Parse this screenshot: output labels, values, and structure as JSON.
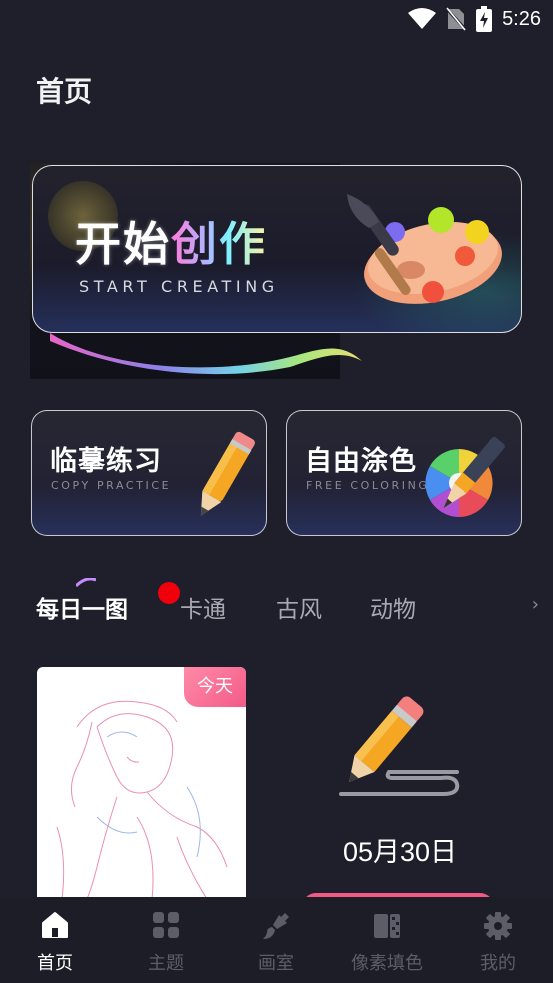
{
  "status_bar": {
    "time": "5:26"
  },
  "header": {
    "title": "首页"
  },
  "hero": {
    "title_white": "开始",
    "title_color": "创作",
    "subtitle": "START CREATING"
  },
  "cards": [
    {
      "title": "临摹练习",
      "subtitle": "COPY PRACTICE"
    },
    {
      "title": "自由涂色",
      "subtitle": "FREE COLORING"
    }
  ],
  "tabs": [
    {
      "label": "每日一图",
      "active": true
    },
    {
      "label": "卡通",
      "active": false
    },
    {
      "label": "古风",
      "active": false
    },
    {
      "label": "动物",
      "active": false
    }
  ],
  "daily": {
    "badge": "今天",
    "date": "05月30日"
  },
  "bottom_nav": [
    {
      "label": "首页",
      "icon": "home-icon",
      "active": true
    },
    {
      "label": "主题",
      "icon": "grid-icon",
      "active": false
    },
    {
      "label": "画室",
      "icon": "brush-icon",
      "active": false
    },
    {
      "label": "像素填色",
      "icon": "pixel-book-icon",
      "active": false
    },
    {
      "label": "我的",
      "icon": "gear-icon",
      "active": false
    }
  ],
  "colors": {
    "background": "#1f1f2b",
    "accent_pink": "#f05a85",
    "badge_red": "#f0000a"
  }
}
